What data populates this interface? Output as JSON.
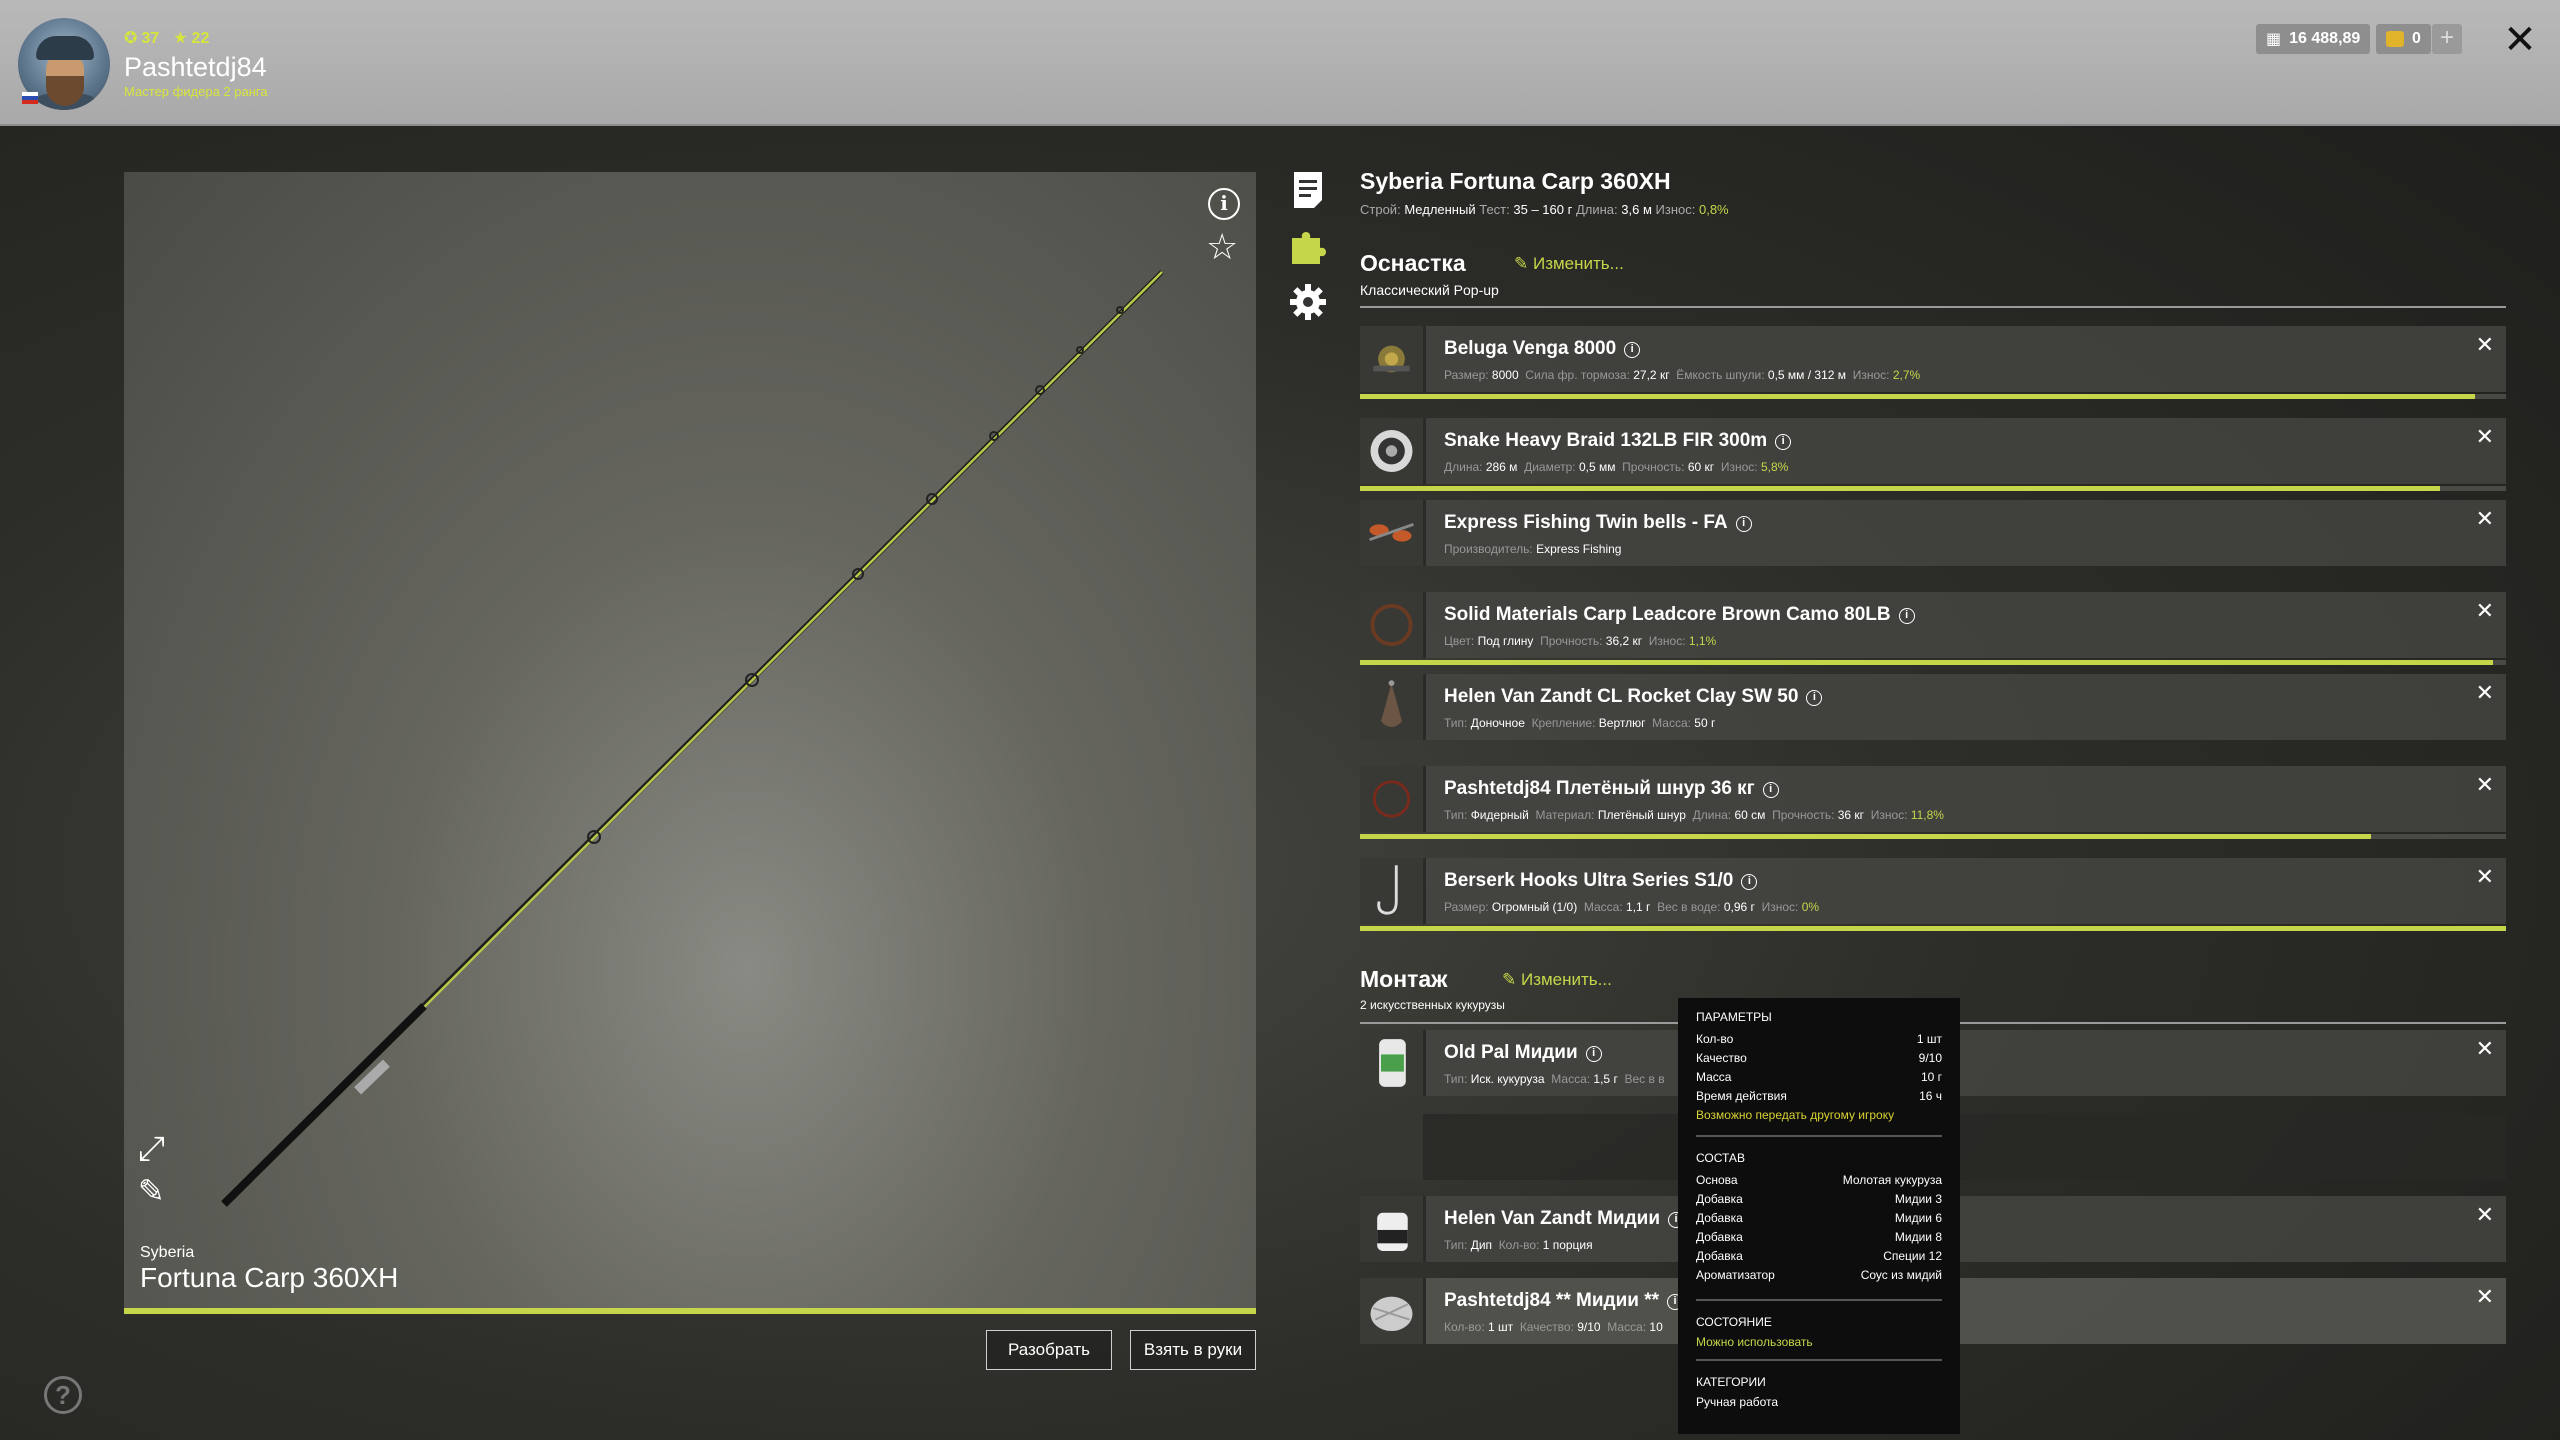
{
  "player": {
    "level": "37",
    "stars": "22",
    "name": "Pashtetdj84",
    "rank": "Мастер фидера 2 ранга"
  },
  "currency": {
    "silver": "16 488,89",
    "gold": "0"
  },
  "preview": {
    "brand": "Syberia",
    "name": "Fortuna Carp 360XH",
    "condition": 1.0,
    "buttons": {
      "disassemble": "Разобрать",
      "take": "Взять в руки"
    }
  },
  "rod": {
    "title": "Syberia Fortuna Carp 360XH",
    "props": [
      {
        "label": "Строй:",
        "value": "Медленный"
      },
      {
        "label": "Тест:",
        "value": "35 – 160 г"
      },
      {
        "label": "Длина:",
        "value": "3,6 м"
      },
      {
        "label": "Износ:",
        "value": "0,8%",
        "accent": true
      }
    ]
  },
  "tackle": {
    "title": "Оснастка",
    "change": "Изменить...",
    "subtitle": "Классический Pop-up",
    "items": [
      {
        "name": "Beluga Venga 8000",
        "props": [
          [
            "Размер:",
            "8000"
          ],
          [
            "Сила фр. тормоза:",
            "27,2 кг"
          ],
          [
            "Ёмкость шпули:",
            "0,5 мм / 312 м"
          ],
          [
            "Износ:",
            "2,7%"
          ]
        ],
        "wear": 0.973
      },
      {
        "name": "Snake Heavy Braid 132LB FIR 300m",
        "props": [
          [
            "Длина:",
            "286 м"
          ],
          [
            "Диаметр:",
            "0,5 мм"
          ],
          [
            "Прочность:",
            "60 кг"
          ],
          [
            "Износ:",
            "5,8%"
          ]
        ],
        "wear": 0.942
      },
      {
        "name": "Express Fishing Twin bells - FA",
        "props": [
          [
            "Производитель:",
            "Express Fishing"
          ]
        ],
        "wear": null
      },
      {
        "name": "Solid Materials Carp Leadcore Brown Camo 80LB",
        "props": [
          [
            "Цвет:",
            "Под глину"
          ],
          [
            "Прочность:",
            "36,2 кг"
          ],
          [
            "Износ:",
            "1,1%"
          ]
        ],
        "wear": 0.989
      },
      {
        "name": "Helen Van Zandt CL Rocket Clay SW 50",
        "props": [
          [
            "Тип:",
            "Доночное"
          ],
          [
            "Крепление:",
            "Вертлюг"
          ],
          [
            "Масса:",
            "50 г"
          ]
        ],
        "wear": null
      },
      {
        "name": "Pashtetdj84 Плетёный шнур 36 кг",
        "props": [
          [
            "Тип:",
            "Фидерный"
          ],
          [
            "Материал:",
            "Плетёный шнур"
          ],
          [
            "Длина:",
            "60 см"
          ],
          [
            "Прочность:",
            "36 кг"
          ],
          [
            "Износ:",
            "11,8%"
          ]
        ],
        "wear": 0.882
      },
      {
        "name": "Berserk Hooks Ultra Series S1/0",
        "props": [
          [
            "Размер:",
            "Огромный (1/0)"
          ],
          [
            "Масса:",
            "1,1 г"
          ],
          [
            "Вес в воде:",
            "0,96 г"
          ],
          [
            "Износ:",
            "0%"
          ]
        ],
        "wear": 1.0
      }
    ]
  },
  "montage": {
    "title": "Монтаж",
    "change": "Изменить...",
    "subtitle": "2 искусственных кукурузы",
    "items": [
      {
        "name": "Old Pal Мидии",
        "props": [
          [
            "Тип:",
            "Иск. кукуруза"
          ],
          [
            "Масса:",
            "1,5 г"
          ],
          [
            "Вес в в",
            ""
          ]
        ]
      },
      {
        "name": "",
        "props": []
      },
      {
        "name": "Helen Van Zandt Мидии",
        "props": [
          [
            "Тип:",
            "Дип"
          ],
          [
            "Кол-во:",
            "1 порция"
          ]
        ]
      },
      {
        "name": "Pashtetdj84 ** Мидии **",
        "props": [
          [
            "Кол-во:",
            "1 шт"
          ],
          [
            "Качество:",
            "9/10"
          ],
          [
            "Масса:",
            "10"
          ]
        ]
      }
    ]
  },
  "tooltip": {
    "params_title": "ПАРАМЕТРЫ",
    "params": [
      [
        "Кол-во",
        "1 шт"
      ],
      [
        "Качество",
        "9/10"
      ],
      [
        "Масса",
        "10 г"
      ],
      [
        "Время действия",
        "16 ч"
      ]
    ],
    "transferable": "Возможно передать другому игроку",
    "comp_title": "СОСТАВ",
    "composition": [
      [
        "Основа",
        "Молотая кукуруза"
      ],
      [
        "Добавка",
        "Мидии 3"
      ],
      [
        "Добавка",
        "Мидии 6"
      ],
      [
        "Добавка",
        "Мидии 8"
      ],
      [
        "Добавка",
        "Специи 12"
      ],
      [
        "Ароматизатор",
        "Соус из мидий"
      ]
    ],
    "state_title": "СОСТОЯНИЕ",
    "state": "Можно использовать",
    "cat_title": "КАТЕГОРИИ",
    "category": "Ручная работа"
  },
  "colors": {
    "accent": "#c6d64a",
    "tooltip_highlight": "#d9d333"
  }
}
